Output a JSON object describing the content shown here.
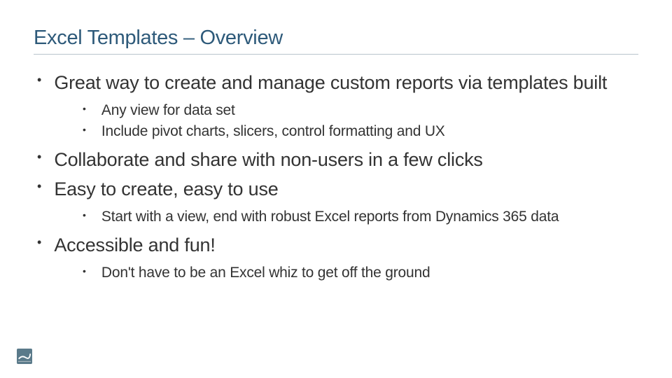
{
  "title": "Excel Templates – Overview",
  "bullets": [
    {
      "text": "Great way to create and manage custom reports via templates built",
      "children": [
        "Any view for data set",
        "Include pivot charts, slicers, control formatting and UX"
      ]
    },
    {
      "text": "Collaborate and share with non-users in a few clicks",
      "children": []
    },
    {
      "text": "Easy to create, easy to use",
      "children": [
        "Start with a view, end with robust Excel reports from Dynamics 365 data"
      ]
    },
    {
      "text": "Accessible and fun!",
      "children": [
        "Don't have to be an Excel whiz to get off the ground"
      ]
    }
  ]
}
